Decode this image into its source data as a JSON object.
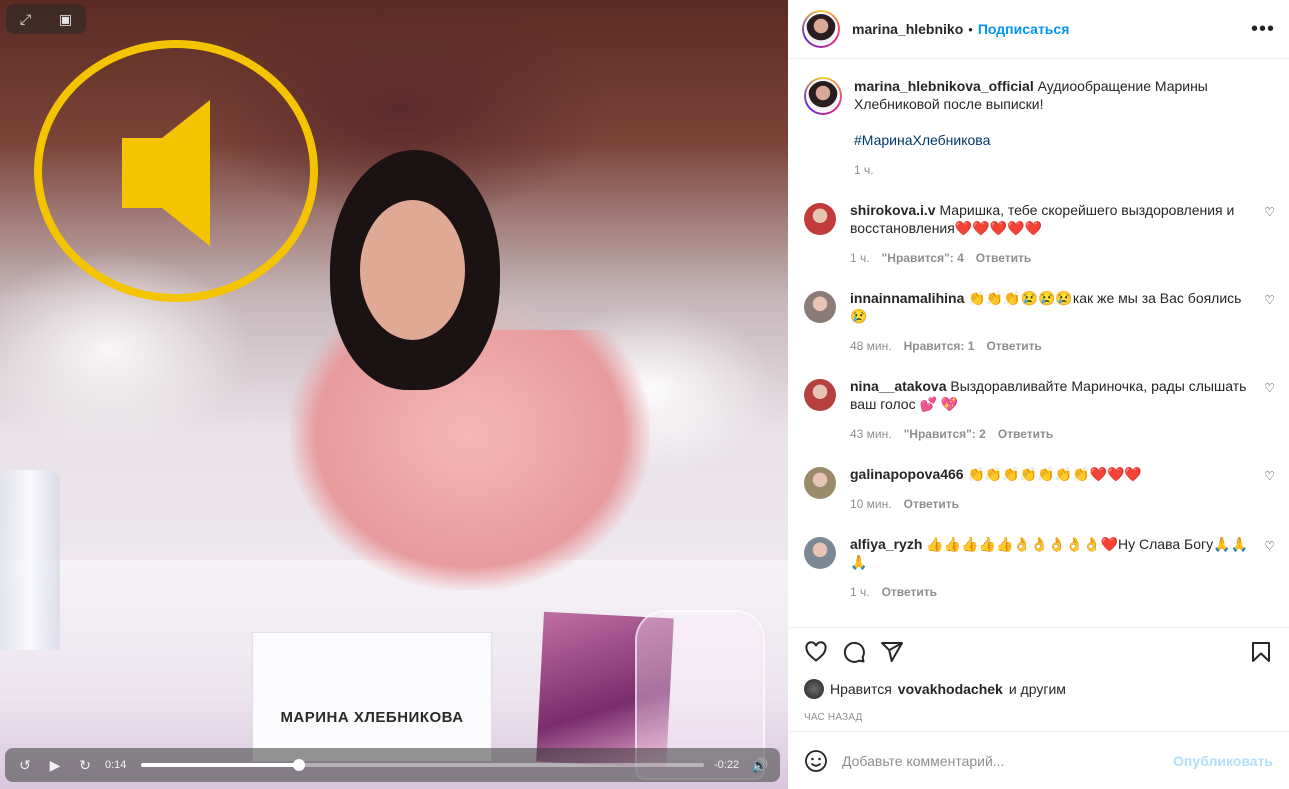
{
  "video": {
    "nameplate": "МАРИНА ХЛЕБНИКОВА",
    "elapsed": "0:14",
    "remaining": "-0:22",
    "progress_fraction": 0.28,
    "icons": {
      "expand": "expand-icon",
      "pip": "picture-in-picture-icon",
      "rewind": "rewind-15-icon",
      "play": "play-icon",
      "forward": "forward-15-icon",
      "volume": "volume-icon",
      "overlay": "speaker-icon"
    },
    "overlay_color": "#f5c400"
  },
  "header": {
    "username": "marina_hlebniko",
    "separator": "•",
    "follow_label": "Подписаться",
    "more_label": "•••"
  },
  "caption": {
    "username": "marina_hlebnikova_official",
    "text": "Аудиообращение Марины Хлебниковой после выписки!",
    "hashtag": "#МаринаХлебникова",
    "time": "1 ч."
  },
  "comments": [
    {
      "username": "shirokova.i.v",
      "text": "Маришка, тебе скорейшего выздоровления и восстановления❤️❤️❤️❤️❤️",
      "time": "1 ч.",
      "likes": "\"Нравится\": 4",
      "reply": "Ответить",
      "avatar_color": "#c23a3a"
    },
    {
      "username": "innainnamalihina",
      "text": "👏👏👏😢😢😢как же мы за Вас боялись😢",
      "time": "48 мин.",
      "likes": "Нравится: 1",
      "reply": "Ответить",
      "avatar_color": "#8a7b77"
    },
    {
      "username": "nina__atakova",
      "text": "Выздоравливайте Мариночка, рады слышать ваш голос 💕 💖",
      "time": "43 мин.",
      "likes": "\"Нравится\": 2",
      "reply": "Ответить",
      "avatar_color": "#b64040"
    },
    {
      "username": "galinapopova466",
      "text": "👏👏👏👏👏👏👏❤️❤️❤️",
      "time": "10 мин.",
      "likes": "",
      "reply": "Ответить",
      "avatar_color": "#9a8b6a"
    },
    {
      "username": "alfiya_ryzh",
      "text": "👍👍👍👍👍👌👌👌👌👌❤️Ну Слава Богу🙏🙏🙏",
      "time": "1 ч.",
      "likes": "",
      "reply": "Ответить",
      "avatar_color": "#7c8894"
    }
  ],
  "actions": {
    "like_icon": "heart-icon",
    "comment_icon": "comment-icon",
    "share_icon": "share-icon",
    "save_icon": "bookmark-icon"
  },
  "likes": {
    "prefix": "Нравится",
    "user": "vovakhodachek",
    "suffix": "и другим"
  },
  "posted_ago": "ЧАС НАЗАД",
  "add_comment": {
    "placeholder": "Добавьте комментарий...",
    "post_label": "Опубликовать"
  }
}
